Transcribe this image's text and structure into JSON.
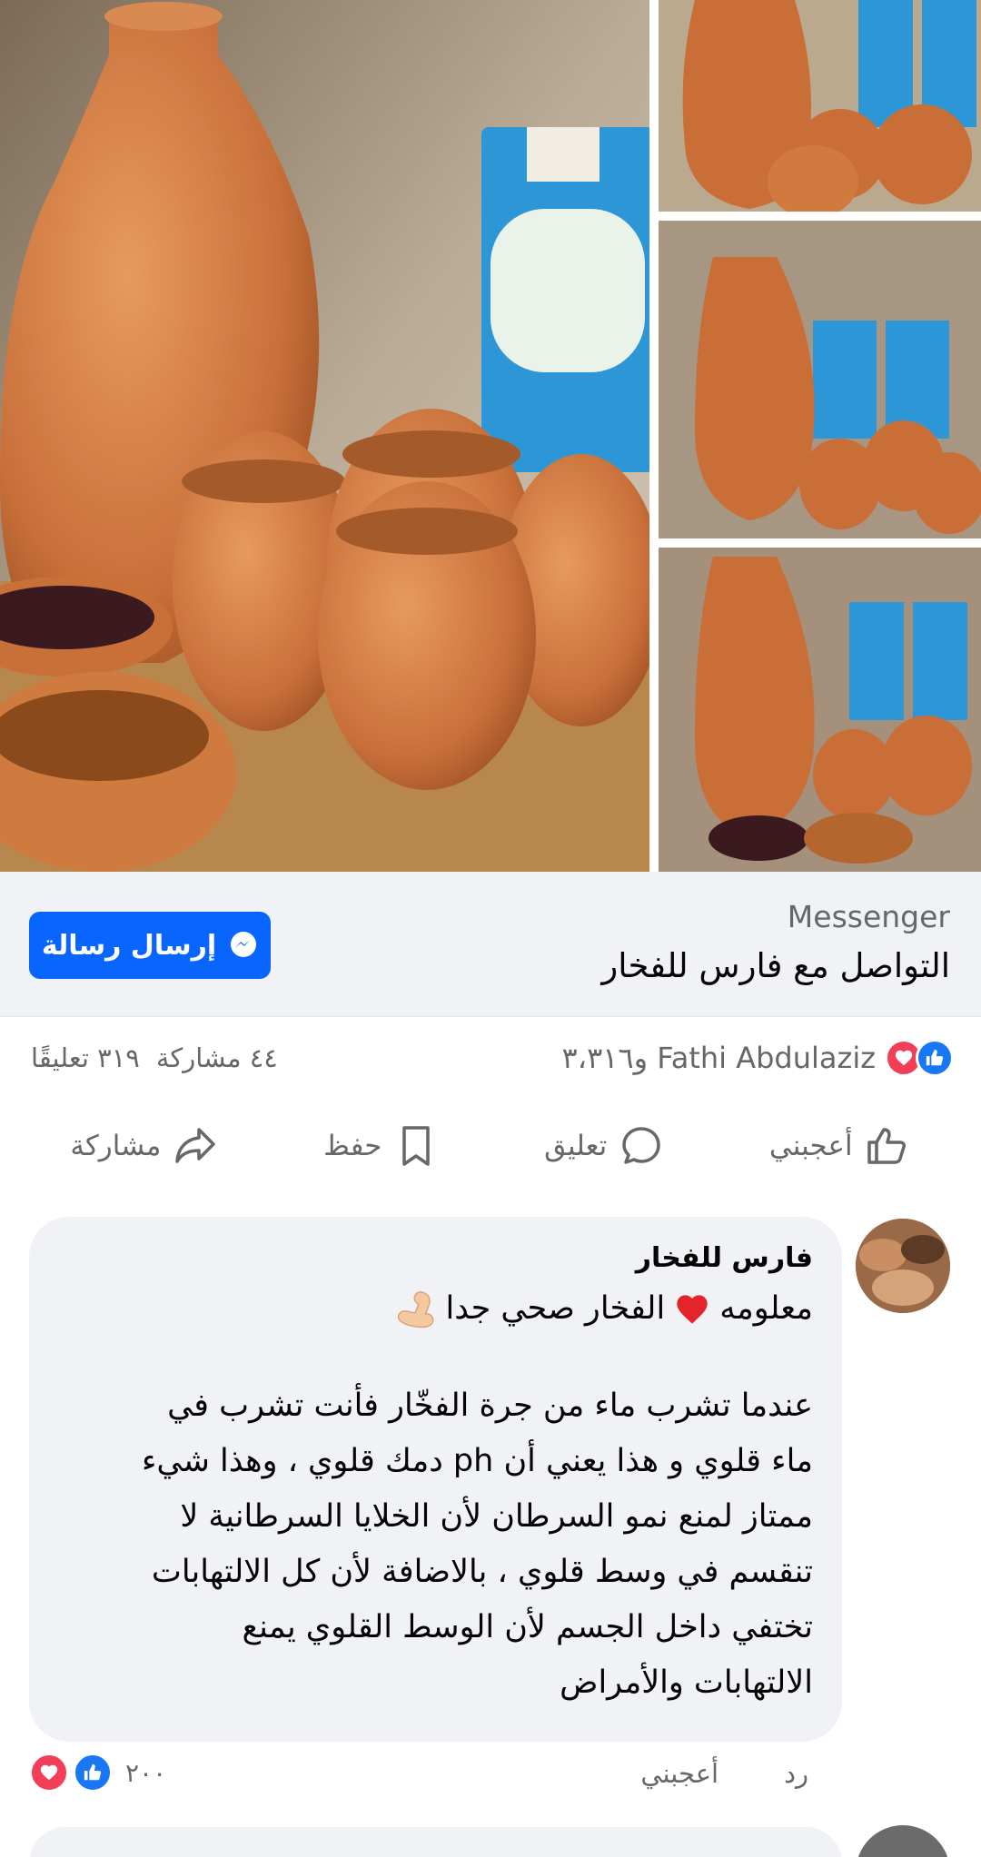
{
  "colors": {
    "brand": "#0866ff",
    "like": "#1877f2",
    "love": "#f33e58",
    "text_secondary": "#65676b"
  },
  "cta": {
    "label_small": "Messenger",
    "title": "التواصل مع فارس للفخار",
    "button_label": "إرسال رسالة",
    "button_icon": "messenger-icon"
  },
  "reactions": {
    "icons": [
      "like-icon",
      "love-icon"
    ],
    "summary": "Fathi Abdulaziz و٣،٣١٦",
    "comments": "٣١٩ تعليقًا",
    "shares": "٤٤ مشاركة"
  },
  "actions": {
    "like": "أعجبني",
    "comment": "تعليق",
    "save": "حفظ",
    "share": "مشاركة"
  },
  "comment": {
    "author": "فارس للفخار",
    "line1_start": "معلومه",
    "line1_end": "الفخار صحي جدا",
    "body_lines": [
      "عندما تشرب ماء من جرة الفخّار فأنت تشرب في",
      "ماء قلوي و هذا يعني أن ph دمك قلوي ، وهذا شيء",
      "ممتاز لمنع نمو السرطان لأن الخلايا السرطانية لا",
      "تنقسم في وسط قلوي ، بالاضافة لأن كل الالتهابات",
      "تختفي داخل الجسم لأن الوسط القلوي يمنع",
      "الالتهابات والأمراض"
    ],
    "like_label": "أعجبني",
    "reply_label": "رد",
    "reaction_count": "٢٠٠"
  }
}
